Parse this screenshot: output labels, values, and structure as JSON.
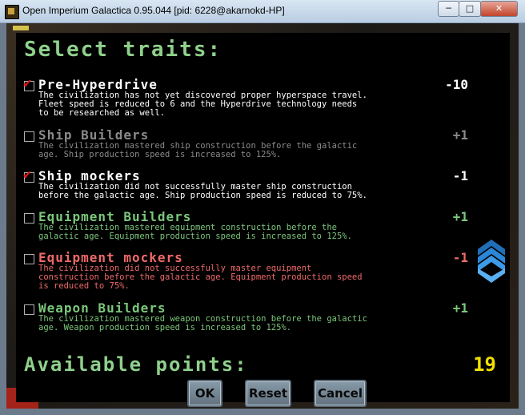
{
  "window": {
    "title": "Open Imperium Galactica 0.95.044 [pid: 6228@akarnokd-HP]",
    "minimize": "─",
    "maximize": "□",
    "close": "✕"
  },
  "dialog": {
    "title": "Select traits:",
    "points_label": "Available points:",
    "points_value": "19",
    "buttons": {
      "ok": "OK",
      "reset": "Reset",
      "cancel": "Cancel"
    }
  },
  "traits": [
    {
      "name": "Pre-Hyperdrive",
      "cost": "-10",
      "checked": true,
      "color": "#ffffff",
      "lines": [
        "The civilization has not yet discovered proper hyperspace travel.",
        "Fleet speed is reduced to 6 and the Hyperdrive technology needs",
        "to be researched as well."
      ]
    },
    {
      "name": "Ship Builders",
      "cost": "+1",
      "checked": false,
      "color": "#8a8a8a",
      "lines": [
        "The civilization mastered ship construction before the galactic",
        "age. Ship production speed is increased to 125%."
      ]
    },
    {
      "name": "Ship mockers",
      "cost": "-1",
      "checked": true,
      "color": "#ffffff",
      "lines": [
        "The civilization did not successfully master ship construction",
        "before the galactic age. Ship production speed is reduced to 75%."
      ]
    },
    {
      "name": "Equipment Builders",
      "cost": "+1",
      "checked": false,
      "color": "#7bc77b",
      "lines": [
        "The civilization mastered equipment construction before the",
        "galactic age. Equipment production speed is increased to 125%."
      ]
    },
    {
      "name": "Equipment mockers",
      "cost": "-1",
      "checked": false,
      "color": "#f06a6a",
      "lines": [
        "The civilization did not successfully master equipment",
        "construction before the galactic age. Equipment production speed",
        "is reduced to 75%."
      ]
    },
    {
      "name": "Weapon Builders",
      "cost": "+1",
      "checked": false,
      "color": "#7bc77b",
      "lines": [
        "The civilization mastered weapon construction before the galactic",
        "age. Weapon production speed is increased to 125%."
      ]
    }
  ]
}
